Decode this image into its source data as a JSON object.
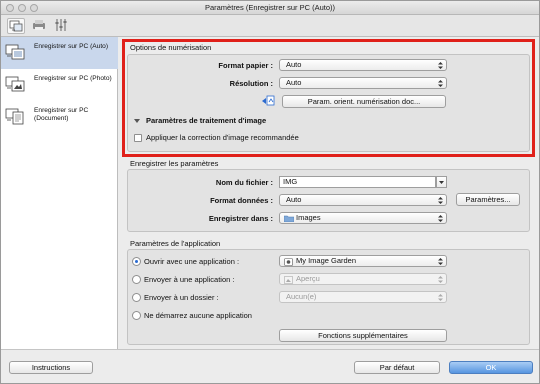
{
  "window": {
    "title": "Paramètres (Enregistrer sur PC (Auto))"
  },
  "toolbar": {
    "icons": [
      "scan-to-pc-tab-icon",
      "printer-tab-icon",
      "general-settings-tab-icon"
    ]
  },
  "sidebar": {
    "items": [
      {
        "label": "Enregistrer sur PC (Auto)",
        "selected": true
      },
      {
        "label": "Enregistrer sur PC (Photo)",
        "selected": false
      },
      {
        "label": "Enregistrer sur PC (Document)",
        "selected": false
      }
    ]
  },
  "scan_options": {
    "title": "Options de numérisation",
    "paper_size_label": "Format papier :",
    "paper_size_value": "Auto",
    "resolution_label": "Résolution :",
    "resolution_value": "Auto",
    "orientation_button": "Param. orient. numérisation doc...",
    "image_processing_label": "Paramètres de traitement d'image",
    "recommended_correction_label": "Appliquer la correction d'image recommandée",
    "recommended_correction_checked": false
  },
  "save_settings": {
    "title": "Enregistrer les paramètres",
    "file_name_label": "Nom du fichier :",
    "file_name_value": "IMG",
    "data_format_label": "Format données :",
    "data_format_value": "Auto",
    "settings_button": "Paramètres...",
    "save_in_label": "Enregistrer dans :",
    "save_in_value": "Images"
  },
  "app_settings": {
    "title": "Paramètres de l'application",
    "open_with_label": "Ouvrir avec une application :",
    "open_with_value": "My Image Garden",
    "send_to_app_label": "Envoyer à une application :",
    "send_to_app_value": "Aperçu",
    "send_to_folder_label": "Envoyer à un dossier :",
    "send_to_folder_value": "Aucun(e)",
    "no_app_label": "Ne démarrez aucune application",
    "more_functions_button": "Fonctions supplémentaires",
    "selected_option": "open_with"
  },
  "footer": {
    "instructions_button": "Instructions",
    "defaults_button": "Par défaut",
    "ok_button": "OK"
  },
  "colors": {
    "highlight": "#e0201a",
    "selection": "#c9d7ec",
    "primary": "#5796e0"
  }
}
